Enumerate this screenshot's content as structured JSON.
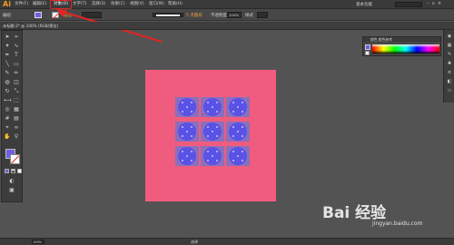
{
  "app": {
    "logo": "Ai",
    "workspace": "基本功能"
  },
  "menu": {
    "items": [
      {
        "label": "文件(F)"
      },
      {
        "label": "编辑(E)"
      },
      {
        "label": "对象(O)"
      },
      {
        "label": "文字(T)"
      },
      {
        "label": "选择(S)"
      },
      {
        "label": "效果(C)"
      },
      {
        "label": "视图(V)"
      },
      {
        "label": "窗口(W)"
      },
      {
        "label": "帮助(H)"
      }
    ],
    "highlighted_item": "对象(O)",
    "highlight_color": "#e02424"
  },
  "control_bar": {
    "selection_label": "编组",
    "stroke_label": "描边",
    "uniform_label": "5 点圆形",
    "opacity_label": "不透明度",
    "opacity_value": "100%",
    "style_label": "样式"
  },
  "document": {
    "tab_label": "未标题-2* @ 100% (RGB/预览)"
  },
  "color_panel": {
    "title": "颜色  颜色参考"
  },
  "status_bar": {
    "zoom": "100%",
    "label": "选择"
  },
  "watermark": {
    "brand": "Bai 经验",
    "url": "jingyan.baidu.com"
  },
  "colors": {
    "artboard": "#f05c7e",
    "tile": "#8a6fbd",
    "circle": "#5a52e6",
    "fill": "#6f5fe0",
    "accent_arrow": "#e02424"
  },
  "icons": [
    "ai-logo",
    "selection-tool-icon",
    "direct-selection-tool-icon",
    "pen-tool-icon",
    "type-tool-icon",
    "line-tool-icon",
    "rectangle-tool-icon",
    "brush-tool-icon",
    "pencil-tool-icon",
    "rotate-tool-icon",
    "scale-tool-icon",
    "gradient-tool-icon",
    "eyedropper-tool-icon",
    "hand-tool-icon",
    "zoom-tool-icon"
  ]
}
